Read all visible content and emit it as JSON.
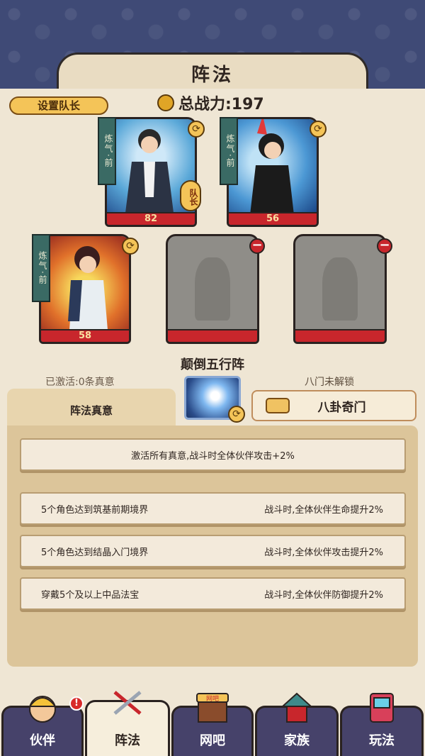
{
  "header": {
    "title": "阵法"
  },
  "team": {
    "set_captain_label": "设置队长",
    "total_power_label": "总战力:197"
  },
  "heroes": [
    {
      "tag": "炼气·前",
      "power": "82",
      "captain_badge": "队长"
    },
    {
      "tag": "炼气·前",
      "power": "56"
    },
    {
      "tag": "炼气·前",
      "power": "58"
    }
  ],
  "formation": {
    "name": "颠倒五行阵",
    "activated_text": "已激活:0条真意",
    "eight_gates_status": "八门未解锁",
    "bagua_button": "八卦奇门",
    "tab_label": "阵法真意"
  },
  "effects": {
    "all_bonus": "激活所有真意,战斗时全体伙伴攻击+2%",
    "rows": [
      {
        "condition": "5个角色达到筑基前期境界",
        "reward": "战斗时,全体伙伴生命提升2%"
      },
      {
        "condition": "5个角色达到结晶入门境界",
        "reward": "战斗时,全体伙伴攻击提升2%"
      },
      {
        "condition": "穿戴5个及以上中品法宝",
        "reward": "战斗时,全体伙伴防御提升2%"
      }
    ]
  },
  "nav": {
    "items": [
      {
        "label": "伙伴"
      },
      {
        "label": "阵法"
      },
      {
        "label": "网吧"
      },
      {
        "label": "家族"
      },
      {
        "label": "玩法"
      }
    ],
    "alert": "!",
    "netcafe_sign": "网吧"
  },
  "colors": {
    "accent": "#c8262c",
    "gold": "#f4c458",
    "nav_bg": "#46426a"
  }
}
